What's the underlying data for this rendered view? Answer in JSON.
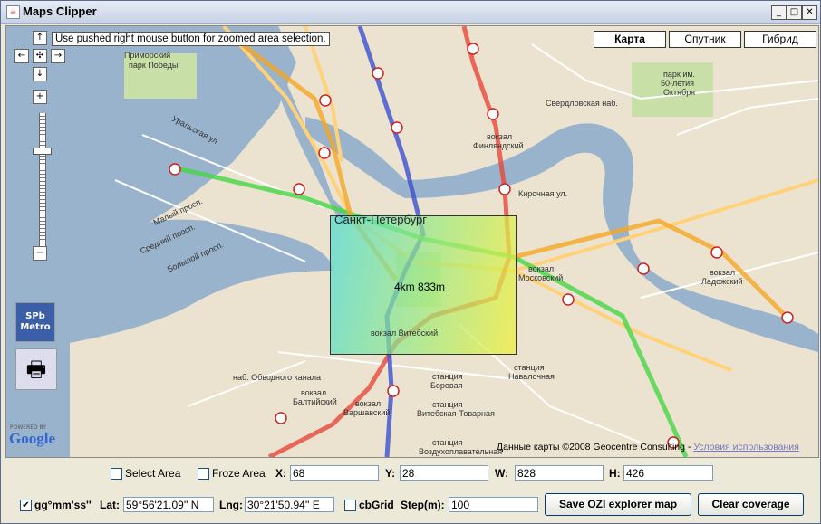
{
  "window": {
    "title": "Maps Clipper",
    "icon": "java-icon"
  },
  "map": {
    "hint": "Use pushed right mouse button for zoomed area selection.",
    "tabs": [
      {
        "label": "Карта",
        "active": true
      },
      {
        "label": "Спутник",
        "active": false
      },
      {
        "label": "Гибрид",
        "active": false
      }
    ],
    "selection_label": "4km 833m",
    "city_label": "Санкт-Петербург",
    "labels": [
      {
        "text": "Приморский"
      },
      {
        "text": "парк Победы"
      },
      {
        "text": "вокзал"
      },
      {
        "text": "Финляндский"
      },
      {
        "text": "Свердловская наб."
      },
      {
        "text": "вокзал"
      },
      {
        "text": "Московский"
      },
      {
        "text": "Кирочная ул."
      },
      {
        "text": "парк им."
      },
      {
        "text": "50-летия"
      },
      {
        "text": "Октября"
      },
      {
        "text": "вокзал"
      },
      {
        "text": "Ладожский"
      },
      {
        "text": "вокзал"
      },
      {
        "text": "Балтийский"
      },
      {
        "text": "вокзал"
      },
      {
        "text": "Варшавский"
      },
      {
        "text": "станция"
      },
      {
        "text": "Боровая"
      },
      {
        "text": "станция"
      },
      {
        "text": "Навалочная"
      },
      {
        "text": "станция"
      },
      {
        "text": "Витебская-Товарная"
      },
      {
        "text": "станция"
      },
      {
        "text": "Воздухоплавательная"
      },
      {
        "text": "наб. Обводного канала"
      },
      {
        "text": "Уральская ул."
      },
      {
        "text": "Средний просп."
      },
      {
        "text": "Малый просп."
      },
      {
        "text": "Большой просп."
      },
      {
        "text": "вокзал Витебский"
      }
    ],
    "powered_by": "POWERED BY",
    "logo": "Google",
    "copyright": "Данные карты ©2008 Geocentre Consulting - ",
    "terms_link": "Условия использования",
    "sidebar": {
      "metro_button": "SPb Metro",
      "print_icon": "printer-icon"
    }
  },
  "controls": {
    "select_area": {
      "label": "Select Area",
      "checked": false
    },
    "froze_area": {
      "label": "Froze Area",
      "checked": false
    },
    "x": {
      "label": "X:",
      "value": "68"
    },
    "y": {
      "label": "Y:",
      "value": "28"
    },
    "w": {
      "label": "W:",
      "value": "828"
    },
    "h": {
      "label": "H:",
      "value": "426"
    },
    "gg_format": {
      "label": "gg°mm'ss''",
      "checked": true
    },
    "lat": {
      "label": "Lat:",
      "value": "59°56'21.09'' N"
    },
    "lng": {
      "label": "Lng:",
      "value": "30°21'50.94'' E"
    },
    "cbgrid": {
      "label": "cbGrid",
      "checked": false
    },
    "step": {
      "label": "Step(m):",
      "value": "100"
    },
    "save_button": "Save OZI explorer map",
    "clear_button": "Clear coverage"
  },
  "colors": {
    "selection_start": "#50dcd2",
    "selection_end": "#f0f03c",
    "water": "#99b3cc",
    "metro_red": "#e8473a",
    "metro_blue": "#3b4fd0",
    "metro_green": "#45d645",
    "metro_orange": "#f5a623"
  }
}
